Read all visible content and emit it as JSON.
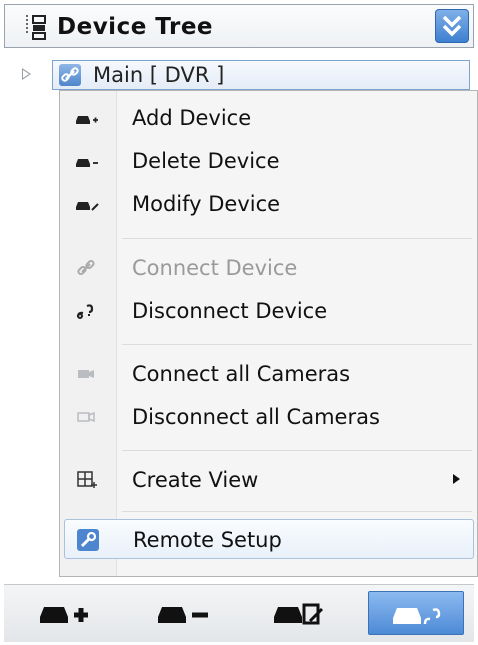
{
  "panel": {
    "title": "Device Tree",
    "icons": {
      "tree": "device-tree-icon",
      "collapse": "double-chevron-down-icon"
    }
  },
  "tree": {
    "root_label": "Main [ DVR ]",
    "root_icon": "link-icon",
    "expanded": false
  },
  "menu": {
    "items": [
      {
        "label": "Add Device",
        "icon": "add-device-icon",
        "enabled": true
      },
      {
        "label": "Delete Device",
        "icon": "delete-device-icon",
        "enabled": true
      },
      {
        "label": "Modify Device",
        "icon": "modify-device-icon",
        "enabled": true
      },
      {
        "label": "Connect Device",
        "icon": "connect-device-icon",
        "enabled": false
      },
      {
        "label": "Disconnect Device",
        "icon": "disconnect-device-icon",
        "enabled": true
      },
      {
        "label": "Connect all Cameras",
        "icon": "camera-icon",
        "enabled": true
      },
      {
        "label": "Disconnect all Cameras",
        "icon": "camera-outline-icon",
        "enabled": true
      },
      {
        "label": "Create View",
        "icon": "create-view-icon",
        "enabled": true,
        "has_submenu": true
      },
      {
        "label": "Remote Setup",
        "icon": "wrench-icon",
        "enabled": true,
        "highlighted": true
      }
    ]
  },
  "toolbar": {
    "buttons": [
      {
        "icon": "add-device-icon"
      },
      {
        "icon": "delete-device-icon"
      },
      {
        "icon": "modify-device-icon"
      },
      {
        "icon": "disconnect-device-icon",
        "active": true
      }
    ]
  },
  "colors": {
    "accent": "#4d8ad6",
    "highlight_border": "#a8c1dd",
    "disabled_text": "#9a9a9a"
  }
}
